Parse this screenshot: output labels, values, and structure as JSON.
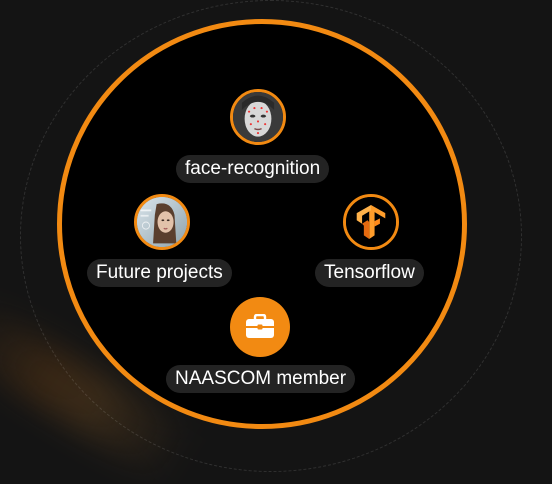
{
  "colors": {
    "accent": "#f28a12",
    "background": "#141414",
    "circle": "#000000",
    "label_bg": "#232323"
  },
  "nodes": {
    "face_recognition": {
      "label": "face-recognition",
      "icon": "face-recognition-photo-icon"
    },
    "future_projects": {
      "label": "Future projects",
      "icon": "future-projects-photo-icon"
    },
    "tensorflow": {
      "label": "Tensorflow",
      "icon": "tensorflow-logo-icon"
    },
    "naascom": {
      "label": "NAASCOM member",
      "icon": "briefcase-icon"
    }
  }
}
